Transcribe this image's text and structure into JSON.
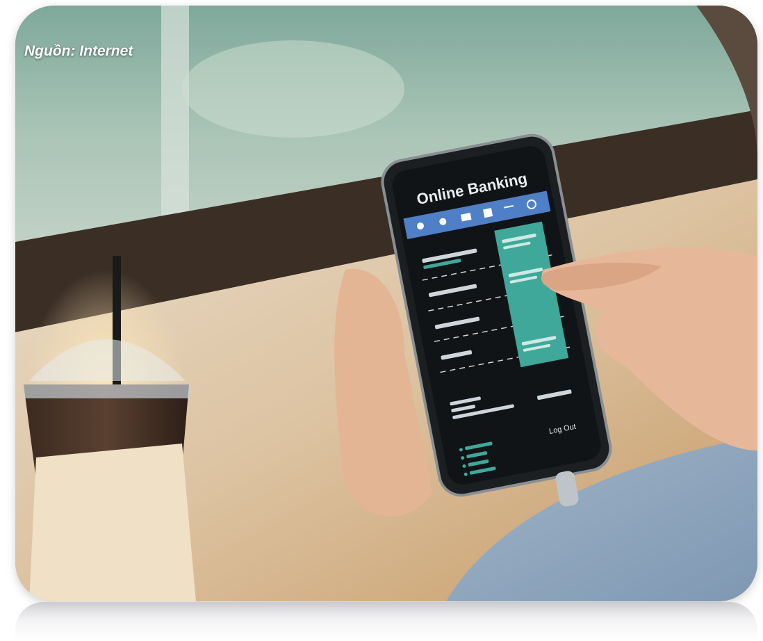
{
  "caption": "Nguồn: Internet",
  "phone": {
    "app_title": "Online Banking",
    "logout_label": "Log Out"
  },
  "colors": {
    "nav_bar": "#4f7fc6",
    "teal_panel": "#3fa89a",
    "screen": "#111417",
    "caption_text": "#ffffff"
  },
  "icons": [
    "user-icon",
    "dollar-icon",
    "card-icon",
    "home-icon",
    "menu-icon",
    "settings-icon"
  ]
}
